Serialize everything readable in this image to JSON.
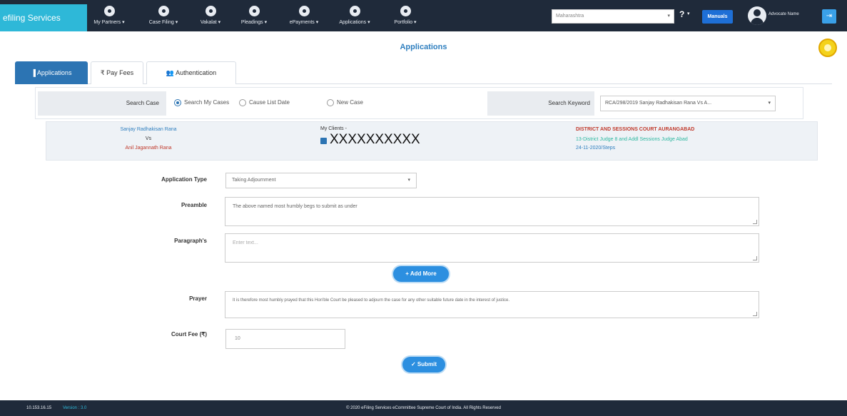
{
  "header": {
    "brand": "efiling Services",
    "nav": [
      {
        "label": "My Partners ▾",
        "icon": "partners-icon"
      },
      {
        "label": "Case Filing ▾",
        "icon": "check-icon"
      },
      {
        "label": "Vakalat ▾",
        "icon": "vakalat-icon"
      },
      {
        "label": "Pleadings ▾",
        "icon": "pleadings-icon"
      },
      {
        "label": "ePayments ▾",
        "icon": "rupee-icon"
      },
      {
        "label": "Applications ▾",
        "icon": "applications-icon"
      },
      {
        "label": "Portfolio ▾",
        "icon": "portfolio-icon"
      }
    ],
    "state_select": "Maharashtra",
    "state_caret": "▾",
    "help": "?",
    "help_caret": "▾",
    "manuals_label": "Manuals",
    "username": "Advocate Name",
    "logout_icon": "⇥"
  },
  "page": {
    "title": "Applications",
    "tabs": [
      {
        "label": "▐ Applications",
        "active": true
      },
      {
        "label": "₹ Pay Fees",
        "active": false
      },
      {
        "label": "👥 Authentication",
        "active": false
      }
    ]
  },
  "search": {
    "case_label": "Search Case",
    "radios": [
      {
        "label": "Search My Cases",
        "selected": true
      },
      {
        "label": "Cause List Date",
        "selected": false
      },
      {
        "label": "New Case",
        "selected": false
      }
    ],
    "keyword_label": "Search Keyword",
    "keyword_value": "RCA/298/2019 Sanjay Radhakisan Rana Vs A...",
    "keyword_caret": "▾"
  },
  "case": {
    "petitioner": "Sanjay Radhakisan Rana",
    "vs": "Vs",
    "respondent": "Anil Jagannath Rana",
    "my_clients_label": "My Clients -",
    "client_name": "XXXXXXXXXX",
    "court_name": "DISTRICT AND SESSIONS COURT AURANGABAD",
    "judge": "13-District Judge 8 and Addl Sessions Judge Abad",
    "hearing": "24-11-2020/Steps"
  },
  "form": {
    "application_type_label": "Application Type",
    "application_type_value": "Taking Adjournment",
    "application_type_caret": "▾",
    "preamble_label": "Preamble",
    "preamble_value": "The above named most humbly begs to submit as under",
    "paragraphs_label": "Paragraph's",
    "paragraphs_placeholder": "Enter text...",
    "add_more_label": "+ Add More",
    "prayer_label": "Prayer",
    "prayer_value": "It is therefore most humbly prayed that this Hon'ble Court be pleased to adjourn the case for any other suitable future date in the interest of justice.",
    "court_fee_label": "Court Fee (₹)",
    "court_fee_value": "10",
    "submit_label": "✓ Submit"
  },
  "footer": {
    "ip": "10.153.16.15",
    "version": "Version : 3.0",
    "copyright": "© 2020 eFiling Services eCommittee Supreme Court of India. All Rights Reserved"
  },
  "colors": {
    "topbar": "#1f2a3a",
    "brand": "#2eb8d8",
    "primary": "#2c74b3",
    "button": "#2c8fe0",
    "danger": "#c0392b"
  }
}
